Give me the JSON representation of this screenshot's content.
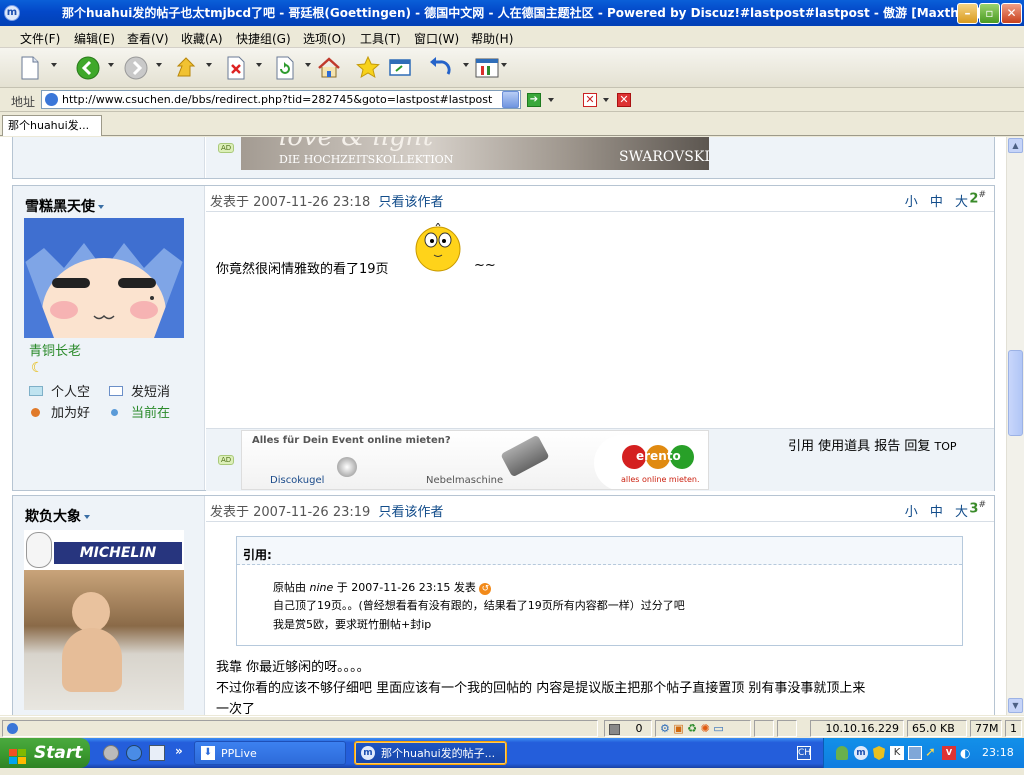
{
  "window": {
    "title": "那个huahui发的帖子也太tmjbcd了吧 - 哥廷根(Goettingen) - 德国中文网 - 人在德国主题社区 - Powered by Discuz!#lastpost#lastpost - 傲游 [Maxthon]"
  },
  "menu": [
    "文件(F)",
    "编辑(E)",
    "查看(V)",
    "收藏(A)",
    "快捷组(G)",
    "选项(O)",
    "工具(T)",
    "窗口(W)",
    "帮助(H)"
  ],
  "toolbar": {
    "icons": [
      "new-window-icon",
      "back-icon",
      "forward-icon",
      "up-icon",
      "stop-icon",
      "refresh-icon",
      "home-icon",
      "favorites-icon",
      "switch-icon",
      "undo-icon",
      "tools-icon"
    ]
  },
  "address": {
    "label": "地址",
    "url": "http://www.csuchen.de/bbs/redirect.php?tid=282745&goto=lastpost#lastpost"
  },
  "tabs": [
    {
      "label": "那个huahui发..."
    }
  ],
  "ads": {
    "top": {
      "script_text": "love & light",
      "caption": "DIE HOCHZEITSKOLLEKTION",
      "brand": "SWAROVSKI",
      "tag": "AD"
    },
    "middle": {
      "tag": "AD",
      "headline": "Alles für Dein Event online mieten?",
      "item1": "Discokugel",
      "item2": "Nebelmaschine",
      "brand": "erento",
      "slogan": "alles online mieten."
    }
  },
  "posts": [
    {
      "username": "雪糕黑天使",
      "rank": "青铜长老",
      "links": {
        "space": "个人空",
        "pm": "发短消",
        "add_friend": "加为好",
        "online": "当前在"
      },
      "date": "发表于 2007-11-26 23:18",
      "author_only": "只看该作者",
      "sizes": "小 中 大",
      "floor": "2",
      "floor_sup": "#",
      "content": "你竟然很闲情雅致的看了19页",
      "tilde": "~~",
      "actions": "引用 使用道具 报告 回复",
      "top_link": "TOP"
    },
    {
      "username": "欺负大象",
      "avatar_text": "MICHELIN",
      "date": "发表于 2007-11-26 23:19",
      "author_only": "只看该作者",
      "sizes": "小 中 大",
      "floor": "3",
      "floor_sup": "#",
      "quote": {
        "header": "引用:",
        "original_prefix": "原帖由 ",
        "original_user": "nine",
        "original_suffix": " 于 2007-11-26 23:15 发表",
        "line1": "自己顶了19页。。(曾经想看看有没有跟的，结果看了19页所有内容都一样）过分了吧",
        "line2": "我是赏5欧，要求斑竹删帖+封ip"
      },
      "line1": "我靠  你最近够闲的呀。。。。",
      "line2": "不过你看的应该不够仔细吧  里面应该有一个我的回帖的  内容是提议版主把那个帖子直接置顶 别有事没事就顶上来",
      "line3": "一次了"
    }
  ],
  "statusbar": {
    "count": "0",
    "ip": "10.10.16.229",
    "size": "65.0 KB",
    "memory": "77M",
    "windows": "1"
  },
  "taskbar": {
    "start": "Start",
    "tasks": [
      "PPLive",
      "那个huahui发的帖子..."
    ],
    "lang": "CH",
    "clock": "23:18"
  }
}
